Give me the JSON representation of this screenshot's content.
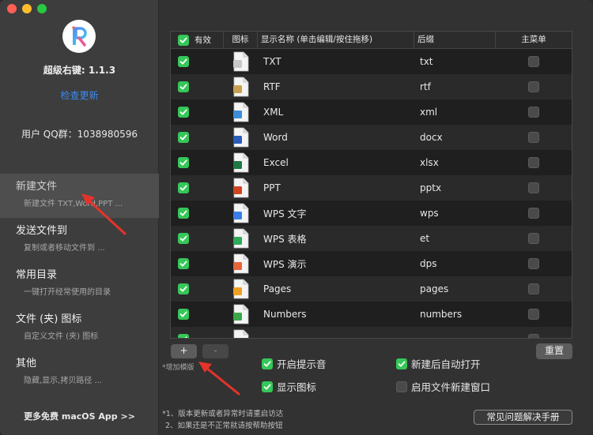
{
  "window": {
    "controls": [
      "close",
      "minimize",
      "zoom"
    ]
  },
  "sidebar": {
    "app_name": "超级右键: 1.1.3",
    "check_update": "检查更新",
    "qq_group": "用户 QQ群：1038980596",
    "items": [
      {
        "title": "新建文件",
        "sub": "新建文件 TXT,Word,PPT ...",
        "active": true
      },
      {
        "title": "发送文件到",
        "sub": "复制或者移动文件到 ...",
        "active": false
      },
      {
        "title": "常用目录",
        "sub": "一键打开经常使用的目录",
        "active": false
      },
      {
        "title": "文件 (夹) 图标",
        "sub": "自定义文件 (夹) 图标",
        "active": false
      },
      {
        "title": "其他",
        "sub": "隐藏,显示,拷贝路径 ...",
        "active": false
      }
    ],
    "more_apps": "更多免费 macOS App >>"
  },
  "table": {
    "headers": {
      "valid": "有效",
      "icon": "图标",
      "name": "显示名称 (单击编辑/按住拖移)",
      "suffix": "后缀",
      "main_menu": "主菜单"
    },
    "rows": [
      {
        "name": "TXT",
        "suffix": "txt",
        "icon": "txt-file-icon",
        "color": "#c8c8c8"
      },
      {
        "name": "RTF",
        "suffix": "rtf",
        "icon": "rtf-file-icon",
        "color": "#c8a050"
      },
      {
        "name": "XML",
        "suffix": "xml",
        "icon": "xml-file-icon",
        "color": "#3a8fd8"
      },
      {
        "name": "Word",
        "suffix": "docx",
        "icon": "word-icon",
        "color": "#2b5cb8"
      },
      {
        "name": "Excel",
        "suffix": "xlsx",
        "icon": "excel-icon",
        "color": "#1f7a45"
      },
      {
        "name": "PPT",
        "suffix": "pptx",
        "icon": "ppt-icon",
        "color": "#d04423"
      },
      {
        "name": "WPS 文字",
        "suffix": "wps",
        "icon": "wps-writer-icon",
        "color": "#3b7de8"
      },
      {
        "name": "WPS 表格",
        "suffix": "et",
        "icon": "wps-sheet-icon",
        "color": "#2eaa5b"
      },
      {
        "name": "WPS 演示",
        "suffix": "dps",
        "icon": "wps-presentation-icon",
        "color": "#e8643a"
      },
      {
        "name": "Pages",
        "suffix": "pages",
        "icon": "pages-icon",
        "color": "#f0a020"
      },
      {
        "name": "Numbers",
        "suffix": "numbers",
        "icon": "numbers-icon",
        "color": "#3aa84a"
      },
      {
        "name": "",
        "suffix": "",
        "icon": "file-icon",
        "color": "#5a9ad8"
      }
    ]
  },
  "controls": {
    "add": "+",
    "remove": "-",
    "add_template": "*增加模版",
    "reset": "重置",
    "faq": "常见问题解决手册"
  },
  "options": {
    "sound": "开启提示音",
    "auto_open": "新建后自动打开",
    "show_icon": "显示图标",
    "new_window": "启用文件新建窗口"
  },
  "notes": {
    "line1": "*1、版本更新或者异常时请重启访达",
    "line2": "2、如果还是不正常就请按帮助按钮"
  }
}
